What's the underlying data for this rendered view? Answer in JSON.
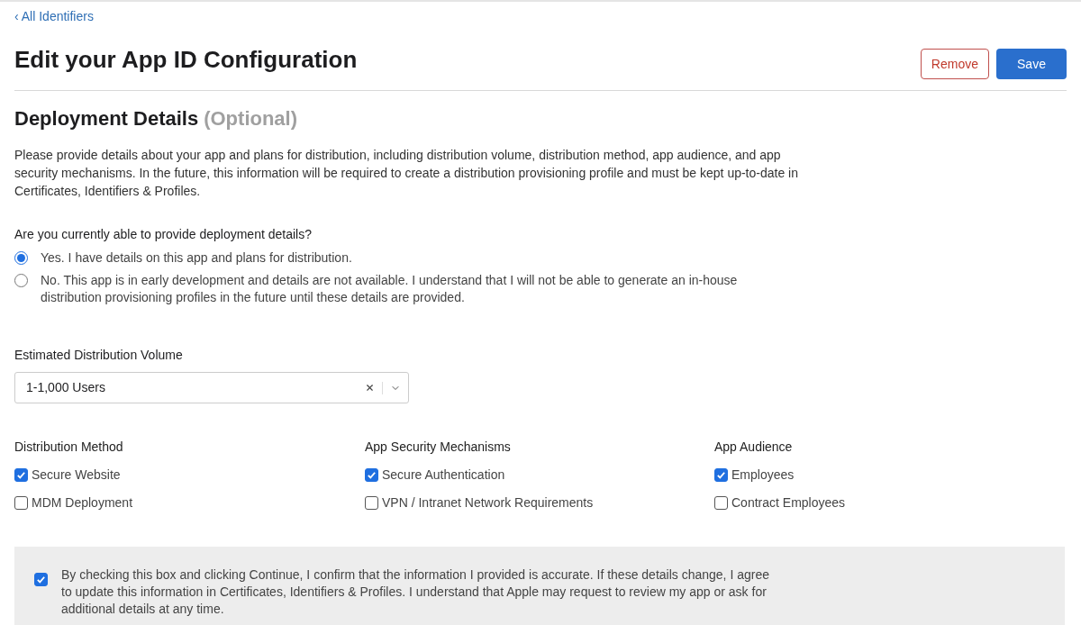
{
  "back_link": "‹ All Identifiers",
  "page_title": "Edit your App ID Configuration",
  "buttons": [
    {
      "label": "Remove",
      "kind": "secondary"
    },
    {
      "label": "Save",
      "kind": "primary"
    }
  ],
  "section": {
    "title": "Deployment Details",
    "optional_label": "(Optional)",
    "description": "Please provide details about your app and plans for distribution, including distribution volume, distribution method, app audience, and app security mechanisms. In the future, this information will be required to create a distribution provisioning profile and must be kept up-to-date in Certificates, Identifiers & Profiles."
  },
  "question": {
    "label": "Are you currently able to provide deployment details?",
    "options": [
      {
        "label": "Yes. I have details on this app and plans for distribution.",
        "selected": true
      },
      {
        "label": "No. This app is in early development and details are not available. I understand that I will not be able to generate an in-house distribution provisioning profiles in the future until these details are provided.",
        "selected": false
      }
    ]
  },
  "volume": {
    "label": "Estimated Distribution Volume",
    "value": "1-1,000 Users"
  },
  "groups": [
    {
      "title": "Distribution Method",
      "items": [
        {
          "label": "Secure Website",
          "checked": true
        },
        {
          "label": "MDM Deployment",
          "checked": false
        }
      ]
    },
    {
      "title": "App Security Mechanisms",
      "items": [
        {
          "label": "Secure Authentication",
          "checked": true
        },
        {
          "label": "VPN / Intranet Network Requirements",
          "checked": false
        }
      ]
    },
    {
      "title": "App Audience",
      "items": [
        {
          "label": "Employees",
          "checked": true
        },
        {
          "label": "Contract Employees",
          "checked": false
        }
      ]
    }
  ],
  "confirmation": {
    "checked": true,
    "text": "By checking this box and clicking Continue, I confirm that the information I provided is accurate. If these details change, I agree to update this information in Certificates, Identifiers & Profiles. I understand that Apple may request to review my app or ask for additional details at any time."
  }
}
